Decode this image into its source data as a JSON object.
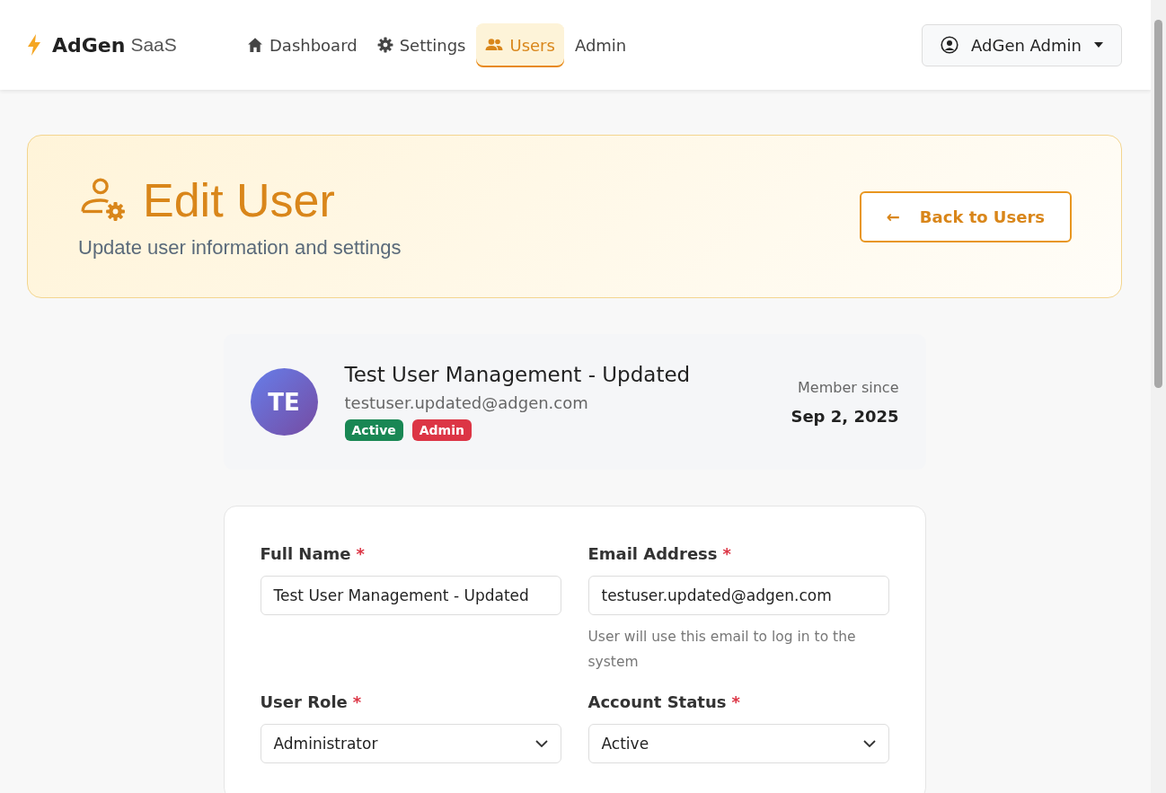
{
  "brand": {
    "name": "AdGen",
    "suffix": "SaaS"
  },
  "nav": [
    {
      "label": "Dashboard",
      "kind": "home",
      "selected": false
    },
    {
      "label": "Settings",
      "kind": "settings",
      "selected": false
    },
    {
      "label": "Users",
      "kind": "users",
      "selected": true
    },
    {
      "label": "Admin",
      "kind": "plain",
      "selected": false
    }
  ],
  "user_menu": {
    "label": "AdGen Admin"
  },
  "header": {
    "title": "Edit User",
    "subtitle": "Update user information and settings",
    "back_button": "Back to Users",
    "back_arrow": "←"
  },
  "profile": {
    "initials": "TE",
    "name": "Test User Management - Updated",
    "email": "testuser.updated@adgen.com",
    "badges": [
      {
        "label": "Active",
        "color": "#198754"
      },
      {
        "label": "Admin",
        "color": "#dc3545"
      }
    ],
    "member_label": "Member since",
    "member_date": "Sep 2, 2025"
  },
  "form": {
    "fields": [
      {
        "kind": "text",
        "label": "Full Name",
        "mark": "*",
        "value": "Test User Management - Updated"
      },
      {
        "kind": "text",
        "label": "Email Address",
        "mark": "*",
        "value": "testuser.updated@adgen.com",
        "help": "User will use this email to log in to the system"
      },
      {
        "kind": "select",
        "label": "User Role",
        "mark": "*",
        "value": "Administrator"
      },
      {
        "kind": "select",
        "label": "Account Status",
        "mark": "*",
        "value": "Active"
      }
    ]
  }
}
